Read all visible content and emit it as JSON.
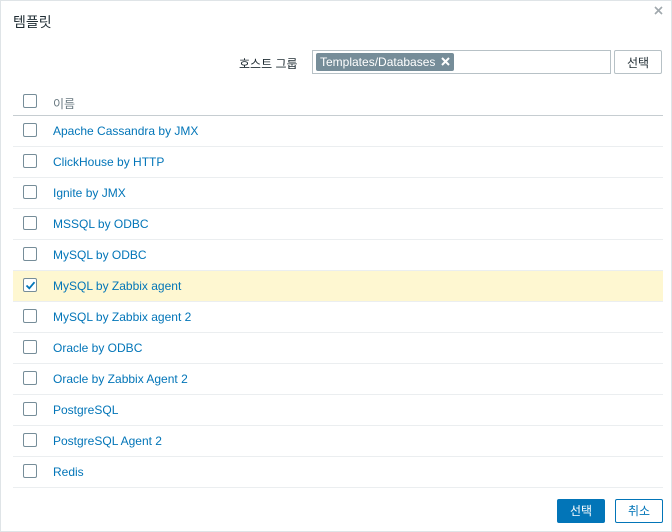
{
  "dialog": {
    "title": "템플릿",
    "close_icon": "close-icon"
  },
  "filter": {
    "label": "호스트 그룹",
    "chips": [
      "Templates/Databases"
    ],
    "select_label": "선택"
  },
  "table": {
    "header": "이름",
    "rows": [
      {
        "name": "Apache Cassandra by JMX",
        "checked": false
      },
      {
        "name": "ClickHouse by HTTP",
        "checked": false
      },
      {
        "name": "Ignite by JMX",
        "checked": false
      },
      {
        "name": "MSSQL by ODBC",
        "checked": false
      },
      {
        "name": "MySQL by ODBC",
        "checked": false
      },
      {
        "name": "MySQL by Zabbix agent",
        "checked": true
      },
      {
        "name": "MySQL by Zabbix agent 2",
        "checked": false
      },
      {
        "name": "Oracle by ODBC",
        "checked": false
      },
      {
        "name": "Oracle by Zabbix Agent 2",
        "checked": false
      },
      {
        "name": "PostgreSQL",
        "checked": false
      },
      {
        "name": "PostgreSQL Agent 2",
        "checked": false
      },
      {
        "name": "Redis",
        "checked": false
      }
    ]
  },
  "footer": {
    "select_label": "선택",
    "cancel_label": "취소"
  },
  "colors": {
    "accent": "#0275b8",
    "selected_row": "#fef7d1",
    "chip": "#768d99"
  }
}
